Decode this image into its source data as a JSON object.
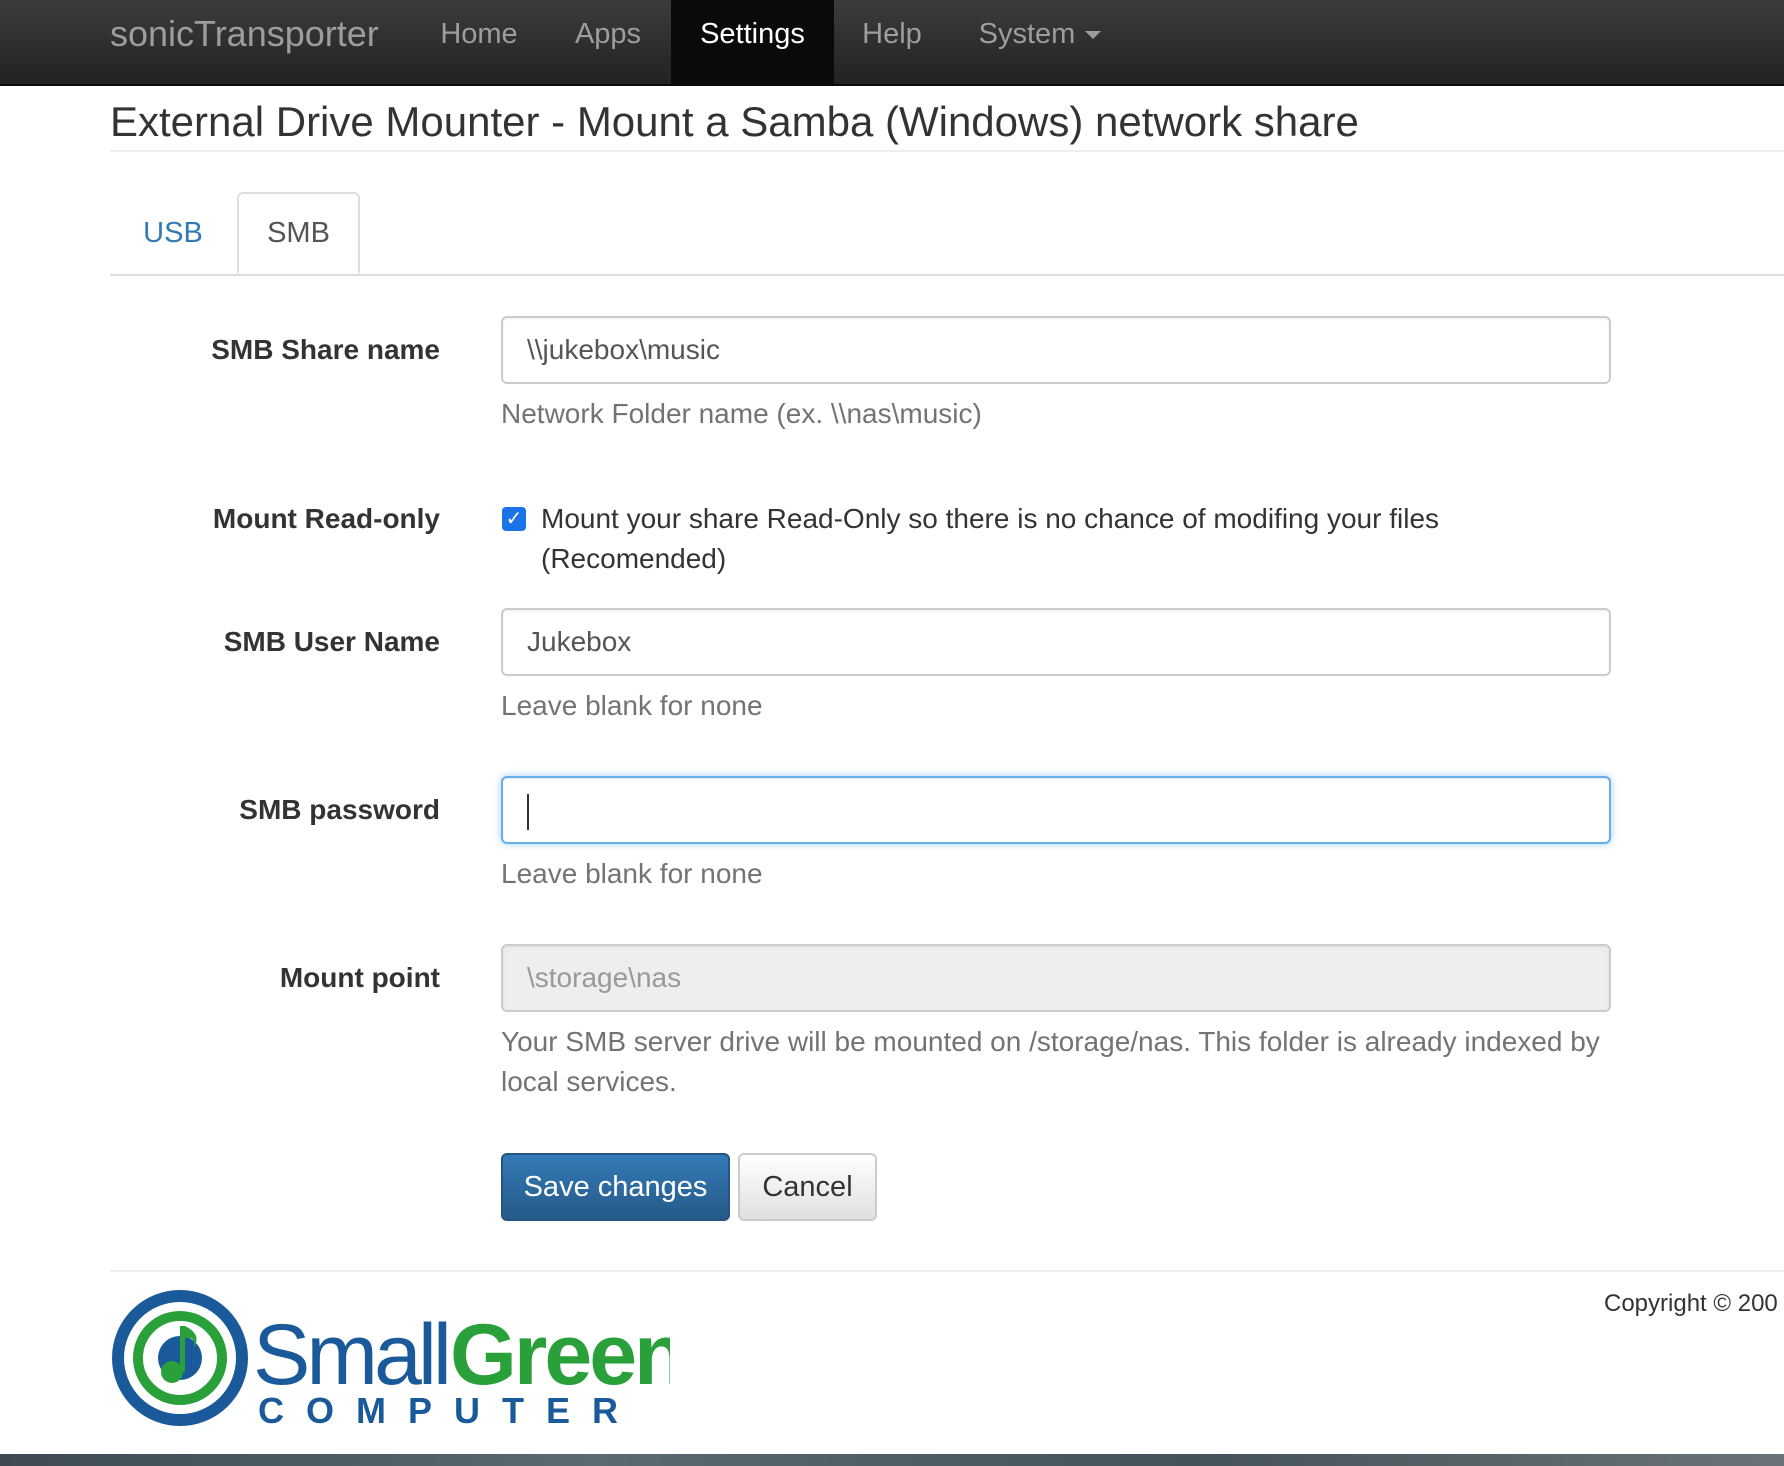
{
  "navbar": {
    "brand": "sonicTransporter",
    "items": [
      {
        "label": "Home"
      },
      {
        "label": "Apps"
      },
      {
        "label": "Settings",
        "active": true
      },
      {
        "label": "Help"
      },
      {
        "label": "System",
        "dropdown": true
      }
    ]
  },
  "page": {
    "title": "External Drive Mounter - Mount a Samba (Windows) network share"
  },
  "tabs": [
    {
      "label": "USB",
      "active": false
    },
    {
      "label": "SMB",
      "active": true
    }
  ],
  "form": {
    "share_name": {
      "label": "SMB Share name",
      "value": "\\\\jukebox\\music",
      "help": "Network Folder name (ex. \\\\nas\\music)"
    },
    "read_only": {
      "label": "Mount Read-only",
      "checked": true,
      "text": "Mount your share Read-Only so there is no chance of modifing your files (Recomended)"
    },
    "user_name": {
      "label": "SMB User Name",
      "value": "Jukebox",
      "help": "Leave blank for none"
    },
    "password": {
      "label": "SMB password",
      "value": "",
      "help": "Leave blank for none"
    },
    "mount_point": {
      "label": "Mount point",
      "value": "\\storage\\nas",
      "help": "Your SMB server drive will be mounted on /storage/nas. This folder is already indexed by local services."
    },
    "save_label": "Save changes",
    "cancel_label": "Cancel"
  },
  "footer": {
    "copyright": "Copyright © 200",
    "logo": {
      "name": "smallgreen-computer-logo",
      "text_small": "Small",
      "text_green": "Green",
      "text_computer": "COMPUTER"
    }
  },
  "colors": {
    "navbar": "#222222",
    "link": "#337ab7",
    "primary": "#2d6ca2",
    "logo_blue": "#1a5a9a",
    "logo_green": "#2aa03a"
  }
}
